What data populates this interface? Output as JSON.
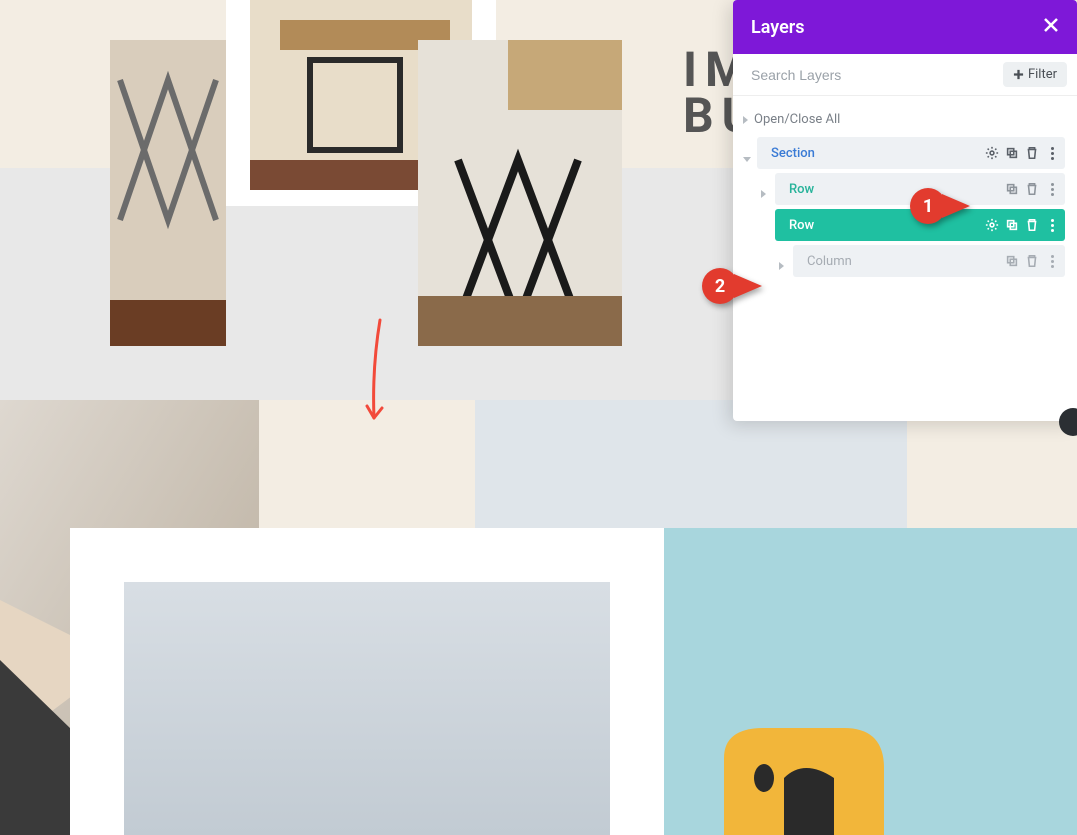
{
  "heading": {
    "line1": "IM",
    "line2": "BU"
  },
  "panel": {
    "title": "Layers",
    "search_placeholder": "Search Layers",
    "filter_label": "Filter",
    "open_close_all": "Open/Close All"
  },
  "tree": {
    "section_label": "Section",
    "row1_label": "Row",
    "row2_label": "Row",
    "column_label": "Column"
  },
  "annotations": {
    "callout1": "1",
    "callout2": "2"
  }
}
